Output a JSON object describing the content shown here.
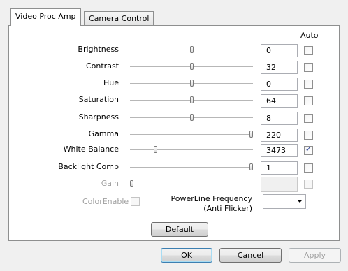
{
  "tabs": [
    "Video Proc Amp",
    "Camera Control"
  ],
  "header": {
    "auto_label": "Auto"
  },
  "properties": [
    {
      "label": "Brightness",
      "value": "0",
      "auto": false,
      "disabled": false
    },
    {
      "label": "Contrast",
      "value": "32",
      "auto": false,
      "disabled": false
    },
    {
      "label": "Hue",
      "value": "0",
      "auto": false,
      "disabled": false
    },
    {
      "label": "Saturation",
      "value": "64",
      "auto": false,
      "disabled": false
    },
    {
      "label": "Sharpness",
      "value": "8",
      "auto": false,
      "disabled": false
    },
    {
      "label": "Gamma",
      "value": "220",
      "auto": false,
      "disabled": false
    },
    {
      "label": "White Balance",
      "value": "3473",
      "auto": true,
      "disabled": false
    },
    {
      "label": "Backlight Comp",
      "value": "1",
      "auto": false,
      "disabled": false
    },
    {
      "label": "Gain",
      "value": "",
      "auto": false,
      "disabled": true
    }
  ],
  "slider_levels": [
    0.5,
    0.5,
    0.5,
    0.5,
    0.5,
    1.0,
    0.2,
    1.0,
    0.0
  ],
  "color_enable": {
    "label": "ColorEnable",
    "checked": false
  },
  "powerline": {
    "label_line1": "PowerLine Frequency",
    "label_line2": "(Anti Flicker)",
    "value": ""
  },
  "buttons": {
    "default": "Default",
    "ok": "OK",
    "cancel": "Cancel",
    "apply": "Apply"
  }
}
